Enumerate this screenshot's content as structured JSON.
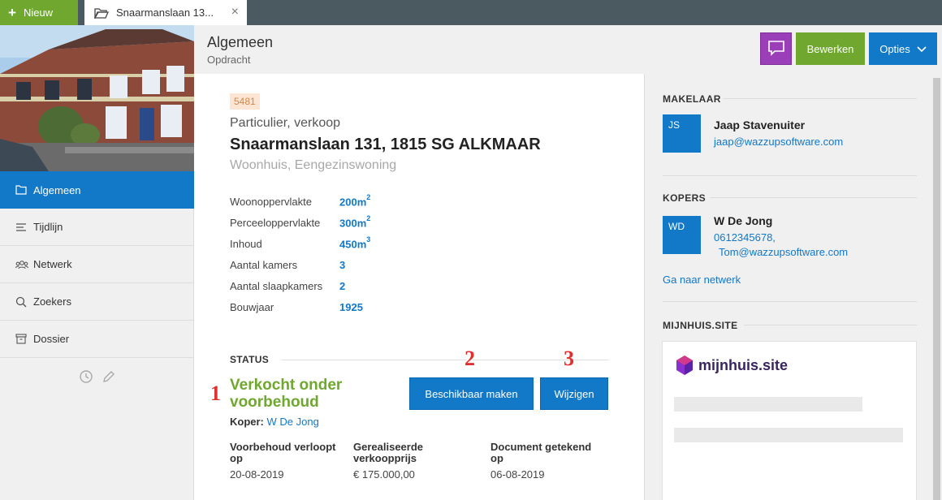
{
  "topbar": {
    "new_label": "Nieuw",
    "tab_label": "Snaarmanslaan 13...",
    "tab_close": "×"
  },
  "sidebar": {
    "items": [
      {
        "label": "Algemeen",
        "icon": "folder-icon",
        "active": true
      },
      {
        "label": "Tijdlijn",
        "icon": "list-icon"
      },
      {
        "label": "Netwerk",
        "icon": "people-icon"
      },
      {
        "label": "Zoekers",
        "icon": "search-icon"
      },
      {
        "label": "Dossier",
        "icon": "archive-icon"
      }
    ]
  },
  "header": {
    "title": "Algemeen",
    "subtitle": "Opdracht",
    "edit_label": "Bewerken",
    "options_label": "Opties"
  },
  "main": {
    "ref": "5481",
    "type": "Particulier, verkoop",
    "address": "Snaarmanslaan 131, 1815 SG ALKMAAR",
    "subtype": "Woonhuis, Eengezinswoning",
    "facts": [
      {
        "label": "Woonoppervlakte",
        "value": "200m",
        "sup": "2"
      },
      {
        "label": "Perceeloppervlakte",
        "value": "300m",
        "sup": "2"
      },
      {
        "label": "Inhoud",
        "value": "450m",
        "sup": "3"
      },
      {
        "label": "Aantal kamers",
        "value": "3",
        "sup": ""
      },
      {
        "label": "Aantal slaapkamers",
        "value": "2",
        "sup": ""
      },
      {
        "label": "Bouwjaar",
        "value": "1925",
        "sup": ""
      }
    ],
    "status_heading": "STATUS",
    "status_value": "Verkocht onder voorbehoud",
    "annotations": [
      "1",
      "2",
      "3"
    ],
    "btn_available": "Beschikbaar maken",
    "btn_change": "Wijzigen",
    "buyer_label": "Koper:",
    "buyer_name": "W De Jong",
    "dates": [
      {
        "label": "Voorbehoud verloopt op",
        "value": "20-08-2019"
      },
      {
        "label": "Gerealiseerde verkoopprijs",
        "value": "€ 175.000,00"
      },
      {
        "label": "Document getekend op",
        "value": "06-08-2019"
      }
    ]
  },
  "right": {
    "agent_heading": "MAKELAAR",
    "agent_initials": "JS",
    "agent_name": "Jaap Stavenuiter",
    "agent_email": "jaap@wazzupsoftware.com",
    "buyers_heading": "KOPERS",
    "buyer_initials": "WD",
    "buyer_name": "W De Jong",
    "buyer_phone": "0612345678,",
    "buyer_email": "Tom@wazzupsoftware.com",
    "network_link": "Ga naar netwerk",
    "site_heading": "MIJNHUIS.SITE",
    "site_logo": "mijnhuis.site"
  },
  "colors": {
    "primary": "#1278c8",
    "green": "#6fa72f",
    "purple": "#9b3fb8",
    "topbar": "#4b5961",
    "annotation_red": "#e03030"
  }
}
